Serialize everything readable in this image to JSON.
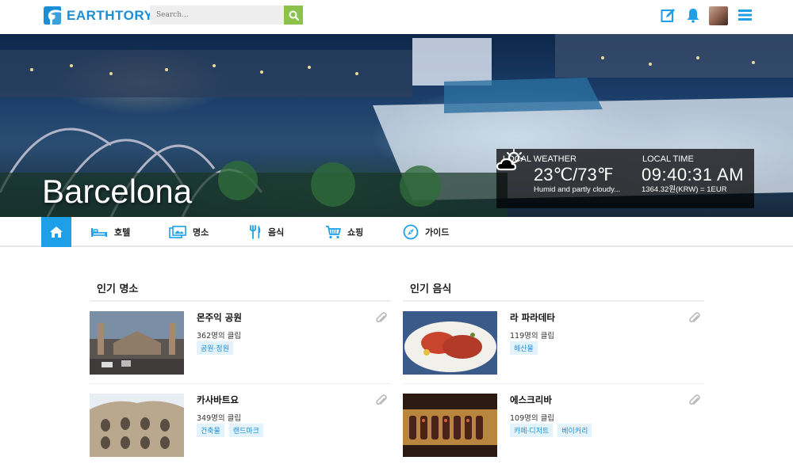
{
  "header": {
    "logo_text": "EARTHTORY",
    "search_placeholder": "Search...",
    "icons": [
      "edit-icon",
      "bell-icon",
      "avatar",
      "menu-icon"
    ],
    "accent": "#1ea0e8",
    "search_button_color": "#8bc34a"
  },
  "hero": {
    "city": "Barcelona",
    "weather": {
      "title": "LOCAL WEATHER",
      "temp": "23℃/73℉",
      "desc": "Humid and partly cloudy..."
    },
    "time": {
      "title": "LOCAL TIME",
      "value": "09:40:31 AM",
      "rate": "1364.32원(KRW) = 1EUR"
    }
  },
  "nav": {
    "items": [
      {
        "label": "호텔",
        "icon": "bed-icon"
      },
      {
        "label": "명소",
        "icon": "picture-icon"
      },
      {
        "label": "음식",
        "icon": "fork-knife-icon"
      },
      {
        "label": "쇼핑",
        "icon": "cart-icon"
      },
      {
        "label": "가이드",
        "icon": "compass-icon"
      }
    ]
  },
  "places": {
    "title": "인기 명소",
    "items": [
      {
        "name": "몬주익 공원",
        "clips": "362명의 클립",
        "tags": [
          "공원·정원"
        ]
      },
      {
        "name": "카사바트요",
        "clips": "349명의 클립",
        "tags": [
          "건축물",
          "랜드마크"
        ]
      }
    ]
  },
  "food": {
    "title": "인기 음식",
    "items": [
      {
        "name": "라 파라데타",
        "clips": "119명의 클립",
        "tags": [
          "해산물"
        ]
      },
      {
        "name": "에스크리바",
        "clips": "109명의 클립",
        "tags": [
          "카페·디저트",
          "베이커리"
        ]
      }
    ]
  }
}
